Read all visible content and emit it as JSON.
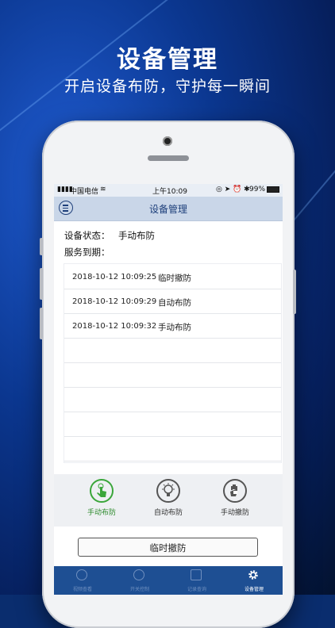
{
  "promo": {
    "headline": "设备管理",
    "subline": "开启设备布防，守护每一瞬间"
  },
  "statusbar": {
    "carrier": "中国电信",
    "time": "上午10:09",
    "battery": "99%"
  },
  "navbar": {
    "title": "设备管理"
  },
  "info": {
    "status_label": "设备状态：",
    "status_value": "手动布防",
    "service_label": "服务到期："
  },
  "log": [
    {
      "time": "2018-10-12 10:09:25",
      "action": "临时撤防"
    },
    {
      "time": "2018-10-12 10:09:29",
      "action": "自动布防"
    },
    {
      "time": "2018-10-12 10:09:32",
      "action": "手动布防"
    }
  ],
  "modes": [
    {
      "label": "手动布防",
      "icon": "hand-tap-icon",
      "active": true
    },
    {
      "label": "自动布防",
      "icon": "lightbulb-icon",
      "active": false
    },
    {
      "label": "手动撤防",
      "icon": "hand-lock-icon",
      "active": false
    }
  ],
  "temp_disarm_label": "临时撤防",
  "tabbar": [
    {
      "label": "视频查看",
      "icon": "camera-icon"
    },
    {
      "label": "开关控制",
      "icon": "switch-icon"
    },
    {
      "label": "记录查询",
      "icon": "clipboard-icon"
    },
    {
      "label": "设备管理",
      "icon": "gear-icon",
      "active": true
    }
  ],
  "colors": {
    "accent_green": "#3aa63a",
    "tabbar_blue": "#1e4f93",
    "nav_blue": "#c9d6e8"
  }
}
